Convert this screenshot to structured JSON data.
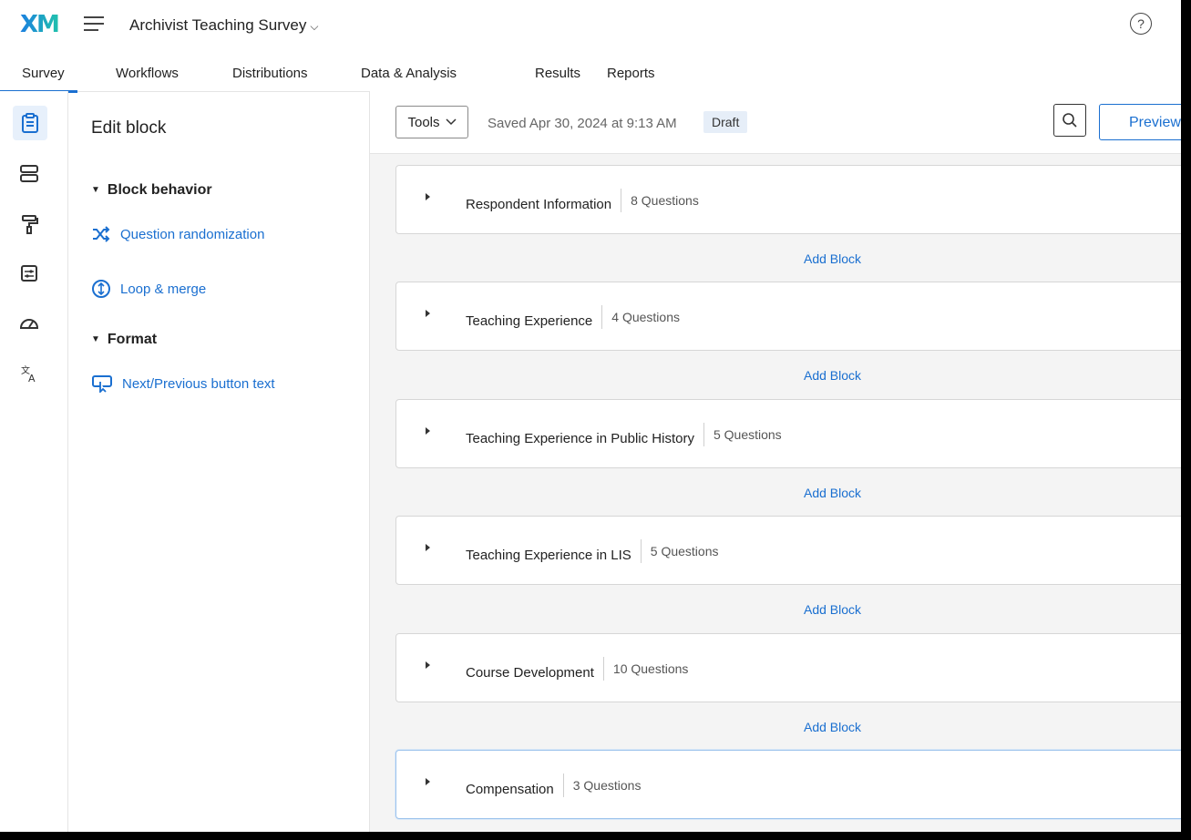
{
  "app": {
    "logo": "XM",
    "project_title": "Archivist Teaching Survey",
    "help": "?"
  },
  "tabs": [
    {
      "label": "Survey",
      "active": true
    },
    {
      "label": "Workflows"
    },
    {
      "label": "Distributions"
    },
    {
      "label": "Data & Analysis"
    },
    {
      "label": "Results"
    },
    {
      "label": "Reports"
    }
  ],
  "rail": [
    "survey-icon",
    "blocks-icon",
    "paint-roller-icon",
    "options-icon",
    "dashboard-icon",
    "translate-icon"
  ],
  "edit_panel": {
    "title": "Edit block",
    "sections": [
      {
        "heading": "Block behavior",
        "items": [
          "Question randomization",
          "Loop & merge"
        ]
      },
      {
        "heading": "Format",
        "items": [
          "Next/Previous button text"
        ]
      }
    ]
  },
  "toolbar": {
    "tools_label": "Tools",
    "saved_text": "Saved Apr 30, 2024 at 9:13 AM",
    "status": "Draft",
    "preview_label": "Preview"
  },
  "blocks": [
    {
      "name": "Respondent Information",
      "count": "8 Questions"
    },
    {
      "name": "Teaching Experience",
      "count": "4 Questions"
    },
    {
      "name": "Teaching Experience in Public History",
      "count": "5 Questions"
    },
    {
      "name": "Teaching Experience in LIS",
      "count": "5 Questions"
    },
    {
      "name": "Course Development",
      "count": "10 Questions"
    },
    {
      "name": "Compensation",
      "count": "3 Questions",
      "selected": true
    }
  ],
  "add_block_label": "Add Block",
  "colors": {
    "accent": "#1a6fd0",
    "draft_bg": "#e6eef8",
    "canvas": "#f4f4f4"
  }
}
